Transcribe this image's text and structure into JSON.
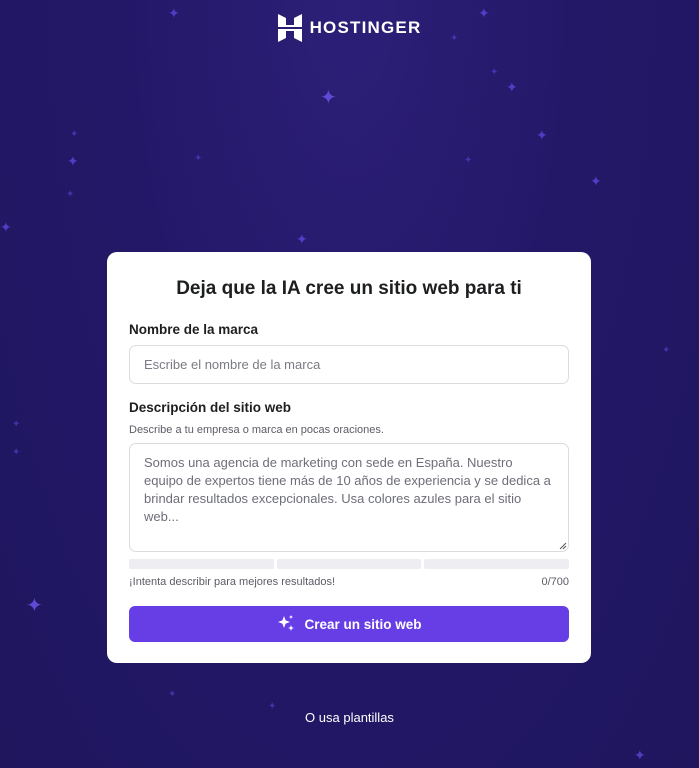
{
  "brand": {
    "logo_text": "HOSTINGER",
    "logo_icon": "hostinger-h-logo"
  },
  "card": {
    "title": "Deja que la IA cree un sitio web para ti",
    "brand_name": {
      "label": "Nombre de la marca",
      "value": "",
      "placeholder": "Escribe el nombre de la marca"
    },
    "description": {
      "label": "Descripción del sitio web",
      "hint": "Describe a tu empresa o marca en pocas oraciones.",
      "value": "",
      "placeholder": "Somos una agencia de marketing con sede en España. Nuestro equipo de expertos tiene más de 10 años de experiencia y se dedica a brindar resultados excepcionales. Usa colores azules para el sitio web..."
    },
    "progress": {
      "segments": 3,
      "filled": 0
    },
    "footer_hint": "¡Intenta describir para mejores resultados!",
    "counter": "0/700",
    "cta": {
      "label": "Crear un sitio web",
      "icon": "sparkle-icon"
    }
  },
  "templates_link": "O usa plantillas",
  "colors": {
    "background": "#231868",
    "accent": "#673de6",
    "star": "#5a43d6",
    "card": "#ffffff"
  }
}
